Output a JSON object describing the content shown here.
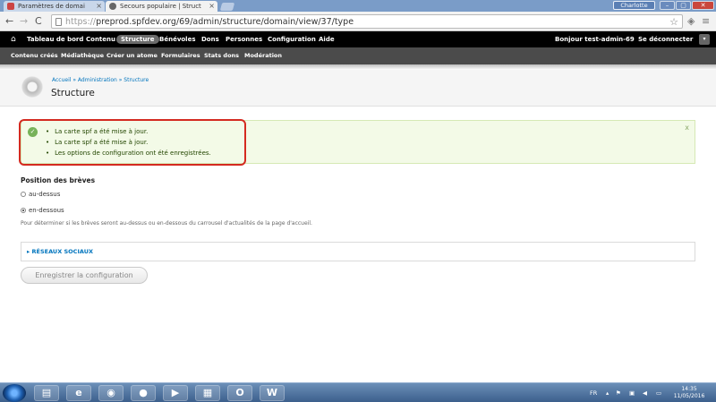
{
  "browser": {
    "tabs": [
      {
        "title": "Paramètres de domai",
        "active": false
      },
      {
        "title": "Secours populaire | Struct",
        "active": true
      }
    ],
    "user_badge": "Charlotte",
    "url_scheme": "https://",
    "url_rest": "preprod.spfdev.org/69/admin/structure/domain/view/37/type"
  },
  "admin_toolbar": {
    "items": [
      "Tableau de bord",
      "Contenu",
      "Structure",
      "Bénévoles",
      "Dons",
      "Personnes",
      "Configuration",
      "Aide"
    ],
    "greeting": "Bonjour",
    "username": "test-admin-69",
    "logout": "Se déconnecter"
  },
  "shortcuts": [
    "Contenu créés",
    "Médiathèque",
    "Créer un atome",
    "Formulaires",
    "Stats dons",
    "Modération"
  ],
  "header": {
    "breadcrumb": "Accueil » Administration » Structure",
    "title": "Structure"
  },
  "messages": {
    "items": [
      "La carte spf a été mise à jour.",
      "La carte spf a été mise à jour.",
      "Les options de configuration ont été enregistrées."
    ],
    "close": "x"
  },
  "form": {
    "label": "Position des brèves",
    "options": [
      {
        "label": "au-dessus",
        "checked": false
      },
      {
        "label": "en-dessous",
        "checked": true
      }
    ],
    "help": "Pour déterminer si les brèves seront au-dessus ou en-dessous du carrousel d'actualités de la page d'accueil.",
    "fieldset_legend": "▸ RÉSEAUX SOCIAUX",
    "submit": "Enregistrer la configuration"
  },
  "taskbar": {
    "lang": "FR",
    "time": "14:35",
    "date": "11/05/2016"
  },
  "colors": {
    "admin_bar": "#000000",
    "shortcut_bar": "#4b4b4b",
    "link": "#0074bd",
    "message_bg": "#f3fae7",
    "highlight": "#d42a20"
  }
}
